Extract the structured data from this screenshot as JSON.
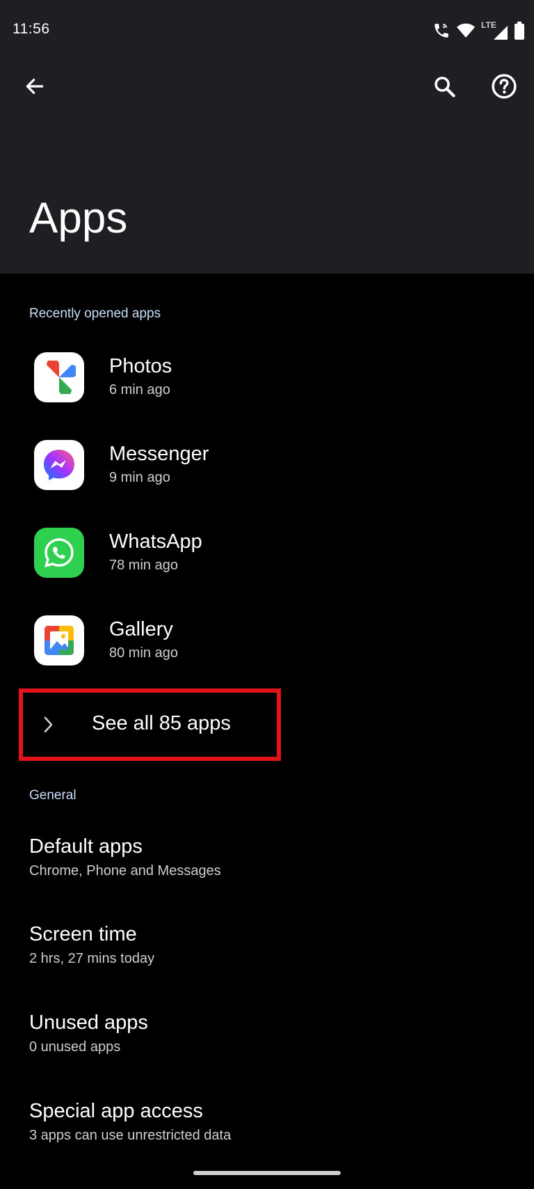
{
  "status_bar": {
    "time": "11:56",
    "network": "LTE",
    "icons": [
      "wifi-calling-icon",
      "wifi-icon",
      "cell-signal-icon",
      "battery-icon"
    ]
  },
  "app_bar": {
    "title": "Apps",
    "back_icon": "arrow-left-icon",
    "search_icon": "search-icon",
    "help_icon": "help-circle-icon"
  },
  "recent": {
    "header": "Recently opened apps",
    "apps": [
      {
        "name": "Photos",
        "sub": "6 min ago",
        "icon": "google-photos-icon"
      },
      {
        "name": "Messenger",
        "sub": "9 min ago",
        "icon": "messenger-icon"
      },
      {
        "name": "WhatsApp",
        "sub": "78 min ago",
        "icon": "whatsapp-icon"
      },
      {
        "name": "Gallery",
        "sub": "80 min ago",
        "icon": "gallery-icon"
      }
    ],
    "see_all": "See all 85 apps"
  },
  "general": {
    "header": "General",
    "items": [
      {
        "title": "Default apps",
        "sub": "Chrome, Phone and Messages"
      },
      {
        "title": "Screen time",
        "sub": "2 hrs, 27 mins today"
      },
      {
        "title": "Unused apps",
        "sub": "0 unused apps"
      },
      {
        "title": "Special app access",
        "sub": "3 apps can use unrestricted data"
      }
    ]
  },
  "colors": {
    "top_background": "#1e1f23",
    "background": "#000000",
    "section_header": "#c9defb",
    "highlight_box": "#e2131a"
  }
}
